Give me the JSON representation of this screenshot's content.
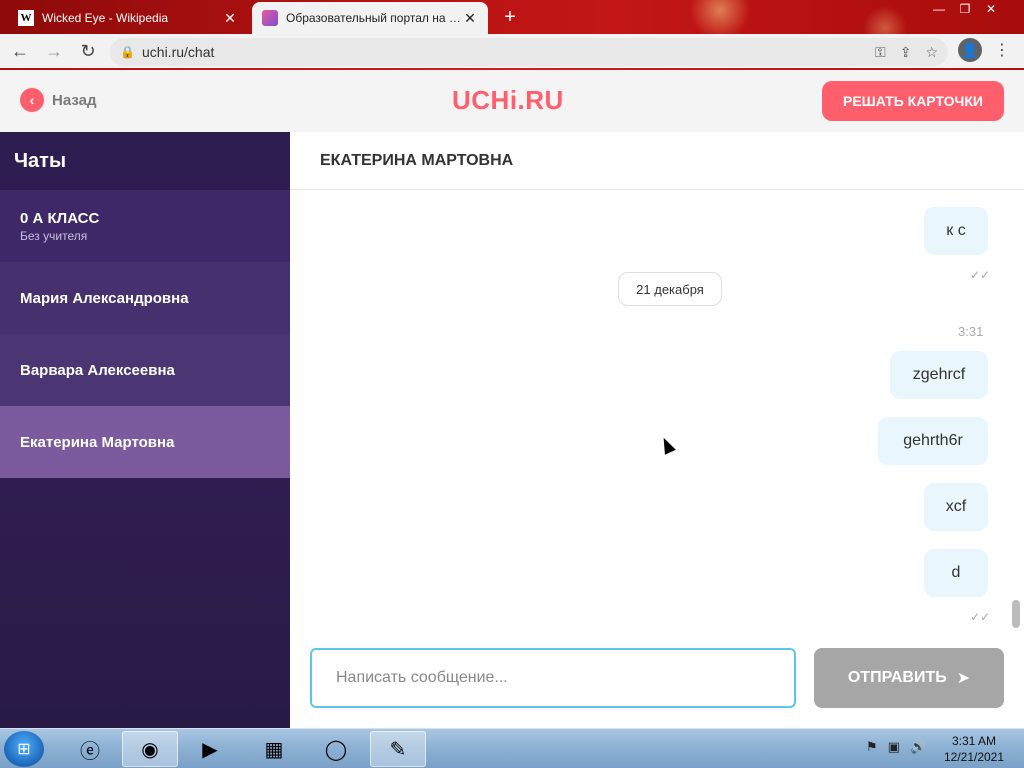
{
  "browser": {
    "tabs": [
      {
        "title": "Wicked Eye - Wikipedia",
        "favicon": "W"
      },
      {
        "title": "Образовательный портал на ба",
        "favicon": ""
      }
    ],
    "new_tab": "+",
    "url": "uchi.ru/chat",
    "window_controls": [
      "—",
      "❐",
      "✕"
    ]
  },
  "header": {
    "back_label": "Назад",
    "logo": "UCHi.RU",
    "solve_button": "РЕШАТЬ КАРТОЧКИ"
  },
  "sidebar": {
    "title": "Чаты",
    "items": [
      {
        "name": "0 А КЛАСС",
        "sub": "Без учителя"
      },
      {
        "name": "Мария Александровна",
        "sub": ""
      },
      {
        "name": "Варвара Алексеевна",
        "sub": ""
      },
      {
        "name": "Екатерина Мартовна",
        "sub": ""
      }
    ]
  },
  "chat": {
    "title": "ЕКАТЕРИНА МАРТОВНА",
    "date": "21 декабря",
    "time": "3:31",
    "messages": [
      "к с",
      "zgehrcf",
      "gehrth6r",
      "xcf",
      "d"
    ],
    "input_placeholder": "Написать сообщение...",
    "send_button": "ОТПРАВИТЬ",
    "read_mark": "✓✓"
  },
  "taskbar": {
    "clock_time": "3:31 AM",
    "clock_date": "12/21/2021"
  },
  "colors": {
    "accent": "#ff5e6c",
    "sidebar": "#3c2566",
    "active_chat": "#7b5a9e",
    "bubble": "#e9f6fc"
  }
}
